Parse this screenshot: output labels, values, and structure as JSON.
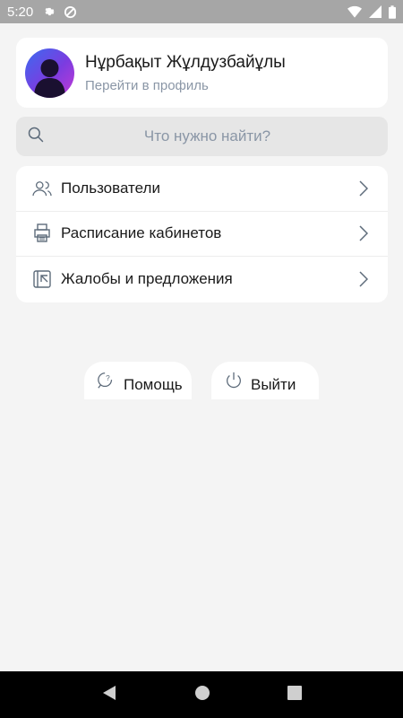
{
  "status_bar": {
    "time": "5:20",
    "icons": [
      "gear-icon",
      "at-icon",
      "wifi-icon",
      "signal-icon",
      "battery-icon"
    ]
  },
  "profile": {
    "name": "Нұрбақыт Жұлдузбайұлы",
    "link": "Перейти в профиль"
  },
  "search": {
    "placeholder": "Что нужно найти?"
  },
  "menu": {
    "items": [
      {
        "label": "Пользователи",
        "icon": "users-icon"
      },
      {
        "label": "Расписание кабинетов",
        "icon": "printer-icon"
      },
      {
        "label": "Жалобы и предложения",
        "icon": "feedback-icon"
      }
    ]
  },
  "actions": {
    "help_label": "Помощь",
    "exit_label": "Выйти"
  },
  "colors": {
    "background": "#f4f4f4",
    "card": "#ffffff",
    "secondary_text": "#8a96a6",
    "status_bar": "#a6a6a6"
  }
}
